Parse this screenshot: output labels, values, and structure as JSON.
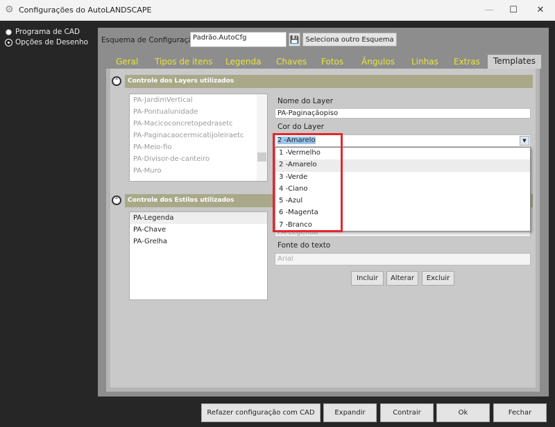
{
  "window": {
    "title": "Configurações do AutoLANDSCAPE",
    "minimize": "—",
    "maximize": "☐",
    "close": "✕"
  },
  "sidebar": {
    "items": [
      {
        "label": "Programa de CAD",
        "selected": false
      },
      {
        "label": "Opções de Desenho",
        "selected": true
      }
    ]
  },
  "scheme": {
    "label": "Esquema de Configuração:",
    "value": "Padrão.AutoCfg",
    "select_button": "Seleciona outro Esquema"
  },
  "tabs": [
    "Geral",
    "Tipos de itens",
    "Legenda",
    "Chaves",
    "Fotos",
    "Ângulos",
    "Linhas",
    "Extras",
    "Templates"
  ],
  "active_tab": "Templates",
  "layers": {
    "header": "Controle dos Layers utilizados",
    "items": [
      "PA-JardimVertical",
      "PA-Pontualunidade",
      "PA-Macicoconcretopedrasetc",
      "PA-Paginacaocermicatijoleiraetc",
      "PA-Meio-fio",
      "PA-Divisor-de-canteiro",
      "PA-Muro"
    ],
    "name_label": "Nome do Layer",
    "name_value": "PA-Paginaçãopiso",
    "color_label": "Cor do Layer",
    "color_value": "2 -Amarelo",
    "color_options": [
      "1 -Vermelho",
      "2 -Amarelo",
      "3 -Verde",
      "4 -Ciano",
      "5 -Azul",
      "6 -Magenta",
      "7 -Branco"
    ]
  },
  "styles": {
    "header": "Controle dos Estilos utilizados",
    "items": [
      "PA-Legenda",
      "PA-Chave",
      "PA-Grelha"
    ],
    "style_value": "PA-Legenda",
    "font_label": "Fonte do texto",
    "font_value": "Arial",
    "buttons": {
      "include": "Incluir",
      "alter": "Alterar",
      "delete": "Excluir"
    }
  },
  "footer": {
    "redo": "Refazer configuração com CAD",
    "expand": "Expandir",
    "collapse": "Contrair",
    "ok": "Ok",
    "close": "Fechar"
  },
  "colors": {
    "tab_text": "#e6e63a",
    "section_header": "#a9a98a",
    "highlight": "#e5262e"
  }
}
